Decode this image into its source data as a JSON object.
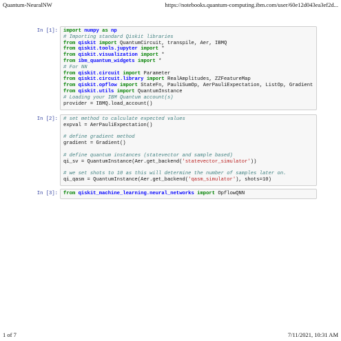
{
  "header": {
    "title": "Quantum-NeuralNW",
    "url": "https://notebooks.quantum-computing.ibm.com/user/60e12d043ea3ef2d..."
  },
  "footer": {
    "page": "1 of 7",
    "datetime": "7/11/2021, 10:31 AM"
  },
  "cells": [
    {
      "prompt": "In [1]:",
      "lines": [
        [
          [
            "kw",
            "import"
          ],
          [
            "tx",
            " "
          ],
          [
            "fn",
            "numpy"
          ],
          [
            "tx",
            " "
          ],
          [
            "kw",
            "as"
          ],
          [
            "tx",
            " "
          ],
          [
            "fn",
            "np"
          ]
        ],
        [
          [
            "cm",
            "# Importing standard Qiskit libraries"
          ]
        ],
        [
          [
            "kw",
            "from"
          ],
          [
            "tx",
            " "
          ],
          [
            "fn",
            "qiskit"
          ],
          [
            "tx",
            " "
          ],
          [
            "kw",
            "import"
          ],
          [
            "tx",
            " QuantumCircuit, transpile, Aer, IBMQ"
          ]
        ],
        [
          [
            "kw",
            "from"
          ],
          [
            "tx",
            " "
          ],
          [
            "fn",
            "qiskit.tools.jupyter"
          ],
          [
            "tx",
            " "
          ],
          [
            "kw",
            "import"
          ],
          [
            "tx",
            " *"
          ]
        ],
        [
          [
            "kw",
            "from"
          ],
          [
            "tx",
            " "
          ],
          [
            "fn",
            "qiskit.visualization"
          ],
          [
            "tx",
            " "
          ],
          [
            "kw",
            "import"
          ],
          [
            "tx",
            " *"
          ]
        ],
        [
          [
            "kw",
            "from"
          ],
          [
            "tx",
            " "
          ],
          [
            "fn",
            "ibm_quantum_widgets"
          ],
          [
            "tx",
            " "
          ],
          [
            "kw",
            "import"
          ],
          [
            "tx",
            " *"
          ]
        ],
        [
          [
            "cm",
            "# For NN"
          ]
        ],
        [
          [
            "kw",
            "from"
          ],
          [
            "tx",
            " "
          ],
          [
            "fn",
            "qiskit.circuit"
          ],
          [
            "tx",
            " "
          ],
          [
            "kw",
            "import"
          ],
          [
            "tx",
            " Parameter"
          ]
        ],
        [
          [
            "kw",
            "from"
          ],
          [
            "tx",
            " "
          ],
          [
            "fn",
            "qiskit.circuit.library"
          ],
          [
            "tx",
            " "
          ],
          [
            "kw",
            "import"
          ],
          [
            "tx",
            " RealAmplitudes, ZZFeatureMap"
          ]
        ],
        [
          [
            "kw",
            "from"
          ],
          [
            "tx",
            " "
          ],
          [
            "fn",
            "qiskit.opflow"
          ],
          [
            "tx",
            " "
          ],
          [
            "kw",
            "import"
          ],
          [
            "tx",
            " StateFn, PauliSumOp, AerPauliExpectation, ListOp, Gradient"
          ]
        ],
        [
          [
            "kw",
            "from"
          ],
          [
            "tx",
            " "
          ],
          [
            "fn",
            "qiskit.utils"
          ],
          [
            "tx",
            " "
          ],
          [
            "kw",
            "import"
          ],
          [
            "tx",
            " QuantumInstance"
          ]
        ],
        [
          [
            "cm",
            "# Loading your IBM Quantum account(s)"
          ]
        ],
        [
          [
            "tx",
            "provider = IBMQ.load_account()"
          ]
        ]
      ]
    },
    {
      "prompt": "In [2]:",
      "lines": [
        [
          [
            "cm",
            "# set method to calculate expected values"
          ]
        ],
        [
          [
            "tx",
            "expval = AerPauliExpectation()"
          ]
        ],
        [
          [
            "tx",
            " "
          ]
        ],
        [
          [
            "cm",
            "# define gradient method"
          ]
        ],
        [
          [
            "tx",
            "gradient = Gradient()"
          ]
        ],
        [
          [
            "tx",
            " "
          ]
        ],
        [
          [
            "cm",
            "# define quantum instances (statevector and sample based)"
          ]
        ],
        [
          [
            "tx",
            "qi_sv = QuantumInstance(Aer.get_backend("
          ],
          [
            "st",
            "'statevector_simulator'"
          ],
          [
            "tx",
            "))"
          ]
        ],
        [
          [
            "tx",
            " "
          ]
        ],
        [
          [
            "cm",
            "# we set shots to 10 as this will determine the number of samples later on."
          ]
        ],
        [
          [
            "tx",
            "qi_qasm = QuantumInstance(Aer.get_backend("
          ],
          [
            "st",
            "'qasm_simulator'"
          ],
          [
            "tx",
            "), shots=10)"
          ]
        ]
      ]
    },
    {
      "prompt": "In [3]:",
      "lines": [
        [
          [
            "kw",
            "from"
          ],
          [
            "tx",
            " "
          ],
          [
            "fn",
            "qiskit_machine_learning.neural_networks"
          ],
          [
            "tx",
            " "
          ],
          [
            "kw",
            "import"
          ],
          [
            "tx",
            " OpflowQNN"
          ]
        ]
      ]
    }
  ]
}
